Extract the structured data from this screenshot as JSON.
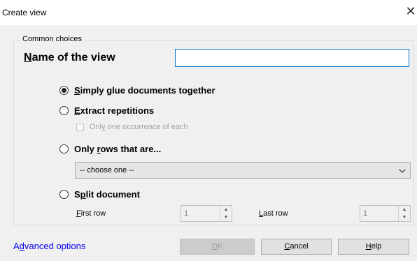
{
  "window": {
    "title": "Create view",
    "close_glyph": "✕"
  },
  "group": {
    "label": "Common choices"
  },
  "name_field": {
    "label_underline": "N",
    "label_rest": "ame of the view",
    "value": ""
  },
  "options": {
    "glue": {
      "u": "S",
      "rest": "imply glue documents together",
      "selected": true
    },
    "extract": {
      "u": "E",
      "rest": "xtract repetitions",
      "selected": false
    },
    "only_one": {
      "pre": "Onl",
      "u": "y",
      "rest": " one occurrence of each",
      "checked": false,
      "enabled": false
    },
    "only_rows": {
      "pre": "Only ",
      "u": "r",
      "rest": "ows that are...",
      "selected": false
    },
    "choose": {
      "value": "-- choose one --"
    },
    "split": {
      "pre": "S",
      "u": "p",
      "rest": "lit document",
      "selected": false
    }
  },
  "split_fields": {
    "first_row": {
      "u": "F",
      "rest": "irst row",
      "value": "1"
    },
    "last_row": {
      "u": "L",
      "rest": "ast row",
      "value": "1"
    }
  },
  "footer": {
    "advanced": {
      "pre": "A",
      "u": "d",
      "rest": "vanced options"
    },
    "ok": {
      "u": "O",
      "rest": "K",
      "enabled": false
    },
    "cancel": {
      "u": "C",
      "rest": "ancel"
    },
    "help": {
      "u": "H",
      "rest": "elp"
    }
  },
  "icons": {
    "chevron_down": "chevron-down-icon",
    "spin_up": "▲",
    "spin_down": "▼"
  },
  "colors": {
    "link": "#0000ee",
    "input_focus_border": "#0078d7",
    "dialog_bg": "#f0f0f0"
  }
}
